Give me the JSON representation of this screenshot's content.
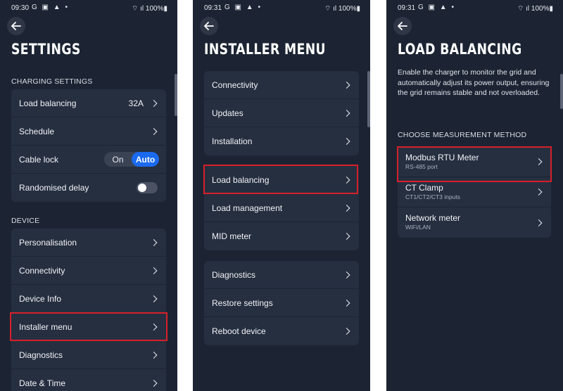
{
  "screen1": {
    "status": {
      "time": "09:30",
      "icons": "G ▣ ▲ •",
      "battery": "100%"
    },
    "title": "SETTINGS",
    "section_charging": "CHARGING SETTINGS",
    "charging_items": [
      {
        "label": "Load balancing",
        "value": "32A"
      },
      {
        "label": "Schedule"
      },
      {
        "label": "Cable lock",
        "segment": [
          "On",
          "Auto"
        ],
        "selected": "Auto"
      },
      {
        "label": "Randomised delay",
        "toggle": false
      }
    ],
    "section_device": "DEVICE",
    "device_items": [
      {
        "label": "Personalisation"
      },
      {
        "label": "Connectivity"
      },
      {
        "label": "Device Info"
      },
      {
        "label": "Installer menu"
      },
      {
        "label": "Diagnostics"
      },
      {
        "label": "Date & Time"
      }
    ]
  },
  "screen2": {
    "status": {
      "time": "09:31",
      "icons": "G ▣ ▲ •",
      "battery": "100%"
    },
    "title": "INSTALLER MENU",
    "group1": [
      {
        "label": "Connectivity"
      },
      {
        "label": "Updates"
      },
      {
        "label": "Installation"
      }
    ],
    "group2": [
      {
        "label": "Load balancing"
      },
      {
        "label": "Load management"
      },
      {
        "label": "MID meter"
      }
    ],
    "group3": [
      {
        "label": "Diagnostics"
      },
      {
        "label": "Restore settings"
      },
      {
        "label": "Reboot device"
      }
    ]
  },
  "screen3": {
    "status": {
      "time": "09:31",
      "icons": "G ▣ ▲ •",
      "battery": "100%"
    },
    "title": "LOAD BALANCING",
    "description": "Enable the charger to monitor the grid and automatically adjust its power output, ensuring the grid remains stable and not overloaded.",
    "section_method": "CHOOSE MEASUREMENT METHOD",
    "methods": [
      {
        "label": "Modbus RTU Meter",
        "sub": "RS-485 port"
      },
      {
        "label": "CT Clamp",
        "sub": "CT1/CT2/CT3 inputs"
      },
      {
        "label": "Network meter",
        "sub": "WiFi/LAN"
      }
    ]
  },
  "colors": {
    "background": "#1c2433",
    "card": "#262f40",
    "accent": "#1a6af0",
    "highlight": "#d6202a"
  }
}
